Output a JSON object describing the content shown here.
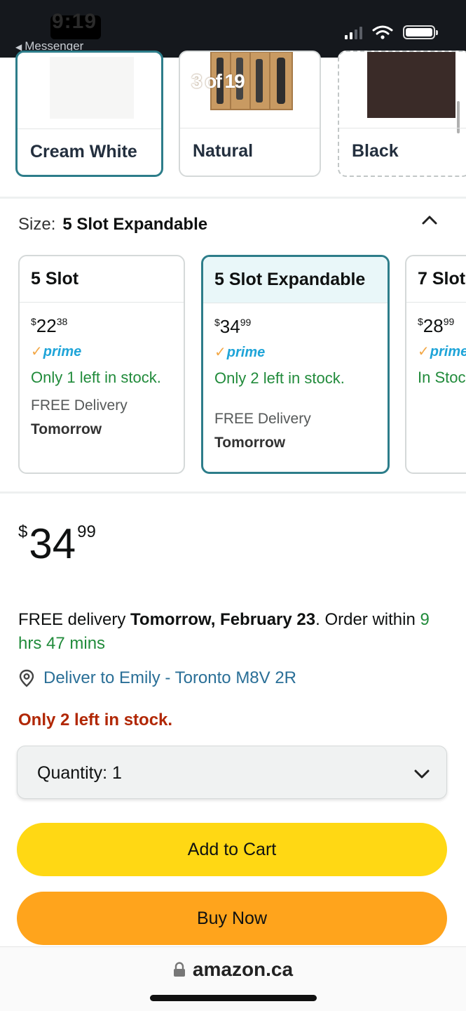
{
  "status_bar": {
    "time": "9:19",
    "back_app": "Messenger"
  },
  "gallery": {
    "counter": "3 of 19"
  },
  "colors": {
    "options": [
      {
        "label": "Cream White",
        "selected": true,
        "swatch": "#f4f4f2"
      },
      {
        "label": "Natural",
        "selected": false,
        "swatch": "#c89a62"
      },
      {
        "label": "Black",
        "selected": false,
        "swatch": "#3a2b28"
      }
    ]
  },
  "size": {
    "label": "Size:",
    "selected": "5 Slot Expandable",
    "options": [
      {
        "title": "5 Slot",
        "price_currency": "$",
        "price_whole": "22",
        "price_cents": "38",
        "prime": "prime",
        "stock": "Only 1 left in stock.",
        "delivery_label": "FREE Delivery",
        "delivery_when": "Tomorrow"
      },
      {
        "title": "5 Slot Expandable",
        "price_currency": "$",
        "price_whole": "34",
        "price_cents": "99",
        "prime": "prime",
        "stock": "Only 2 left in stock.",
        "delivery_label": "FREE Delivery",
        "delivery_when": "Tomorrow"
      },
      {
        "title": "7 Slot",
        "price_currency": "$",
        "price_whole": "28",
        "price_cents": "99",
        "prime": "prime",
        "stock": "In Stock"
      }
    ]
  },
  "price": {
    "currency": "$",
    "whole": "34",
    "cents": "99"
  },
  "delivery": {
    "prefix": "FREE delivery ",
    "date": "Tomorrow, February 23",
    "mid": ". Order within ",
    "countdown": "9 hrs 47 mins"
  },
  "deliver_to": "Deliver to Emily - Toronto M8V 2R",
  "low_stock": "Only 2 left in stock.",
  "quantity": {
    "label": "Quantity: 1"
  },
  "buttons": {
    "add_to_cart": "Add to Cart",
    "buy_now": "Buy Now"
  },
  "browser": {
    "url": "amazon.ca"
  }
}
